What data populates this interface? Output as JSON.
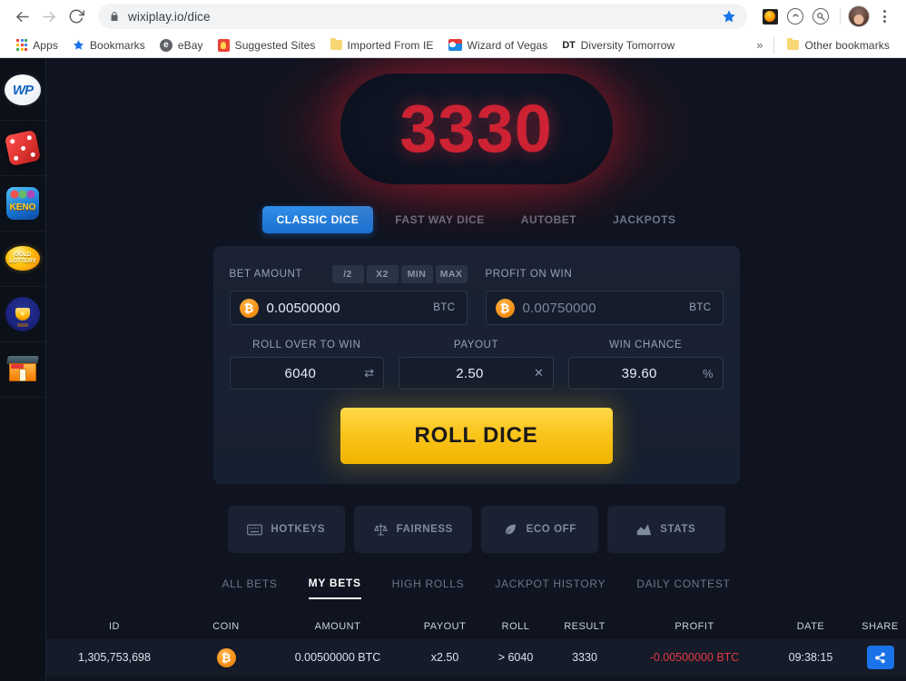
{
  "browser": {
    "url": "wixiplay.io/dice",
    "back_icon": "back-arrow-icon",
    "forward_icon": "forward-arrow-icon",
    "reload_icon": "reload-icon",
    "lock_icon": "lock-icon",
    "star_icon": "bookmark-star-icon",
    "menu_icon": "kebab-menu-icon",
    "bookmarks": [
      {
        "label": "Apps",
        "icon": "apps-grid-icon"
      },
      {
        "label": "Bookmarks",
        "icon": "star-icon"
      },
      {
        "label": "eBay",
        "icon": "ebay-icon"
      },
      {
        "label": "Suggested Sites",
        "icon": "lightbulb-icon"
      },
      {
        "label": "Imported From IE",
        "icon": "folder-icon"
      },
      {
        "label": "Wizard of Vegas",
        "icon": "vegas-icon"
      },
      {
        "label": "Diversity Tomorrow",
        "icon": "dt-icon"
      }
    ],
    "overflow_label": "»",
    "other_bookmarks": "Other bookmarks"
  },
  "sidebar": {
    "items": [
      {
        "name": "wp-logo",
        "label": "WP"
      },
      {
        "name": "dice-game",
        "label": "Dice"
      },
      {
        "name": "keno-game",
        "label": "KENO"
      },
      {
        "name": "gold-lottery-game",
        "label_line1": "GOLD",
        "label_line2": "LOTTERY"
      },
      {
        "name": "tournament",
        "label": "Trophy"
      },
      {
        "name": "shop",
        "label": "Shop"
      }
    ]
  },
  "result": {
    "number": "3330",
    "color": "#cc2233"
  },
  "mode_tabs": [
    {
      "label": "CLASSIC DICE",
      "active": true
    },
    {
      "label": "FAST WAY DICE",
      "active": false
    },
    {
      "label": "AUTOBET",
      "active": false
    },
    {
      "label": "JACKPOTS",
      "active": false
    }
  ],
  "bet_panel": {
    "bet_amount": {
      "label": "BET AMOUNT",
      "value": "0.00500000",
      "unit": "BTC",
      "coin_icon": "bitcoin-icon",
      "quick_buttons": [
        "/2",
        "X2",
        "MIN",
        "MAX"
      ]
    },
    "profit_on_win": {
      "label": "PROFIT ON WIN",
      "value": "0.00750000",
      "unit": "BTC",
      "coin_icon": "bitcoin-icon"
    },
    "roll_over": {
      "label": "ROLL OVER TO WIN",
      "value": "6040",
      "suffix": "⇄"
    },
    "payout": {
      "label": "PAYOUT",
      "value": "2.50",
      "suffix": "✕"
    },
    "win_chance": {
      "label": "WIN CHANCE",
      "value": "39.60",
      "suffix": "%"
    },
    "roll_button": "ROLL DICE"
  },
  "tools": [
    {
      "label": "HOTKEYS",
      "icon": "keyboard-icon"
    },
    {
      "label": "FAIRNESS",
      "icon": "scales-icon"
    },
    {
      "label": "ECO OFF",
      "icon": "leaf-icon"
    },
    {
      "label": "STATS",
      "icon": "chart-icon"
    }
  ],
  "bets_tabs": [
    {
      "label": "ALL BETS",
      "active": false
    },
    {
      "label": "MY BETS",
      "active": true
    },
    {
      "label": "HIGH ROLLS",
      "active": false
    },
    {
      "label": "JACKPOT HISTORY",
      "active": false
    },
    {
      "label": "DAILY CONTEST",
      "active": false
    }
  ],
  "bets_table": {
    "columns": [
      "ID",
      "COIN",
      "AMOUNT",
      "PAYOUT",
      "ROLL",
      "RESULT",
      "PROFIT",
      "DATE",
      "SHARE"
    ],
    "rows": [
      {
        "id": "1,305,753,698",
        "coin": "bitcoin-icon",
        "amount": "0.00500000 BTC",
        "payout": "x2.50",
        "roll": "> 6040",
        "result": "3330",
        "profit": "-0.00500000 BTC",
        "profit_negative": true,
        "date": "09:38:15",
        "share_icon": "share-icon"
      }
    ]
  }
}
